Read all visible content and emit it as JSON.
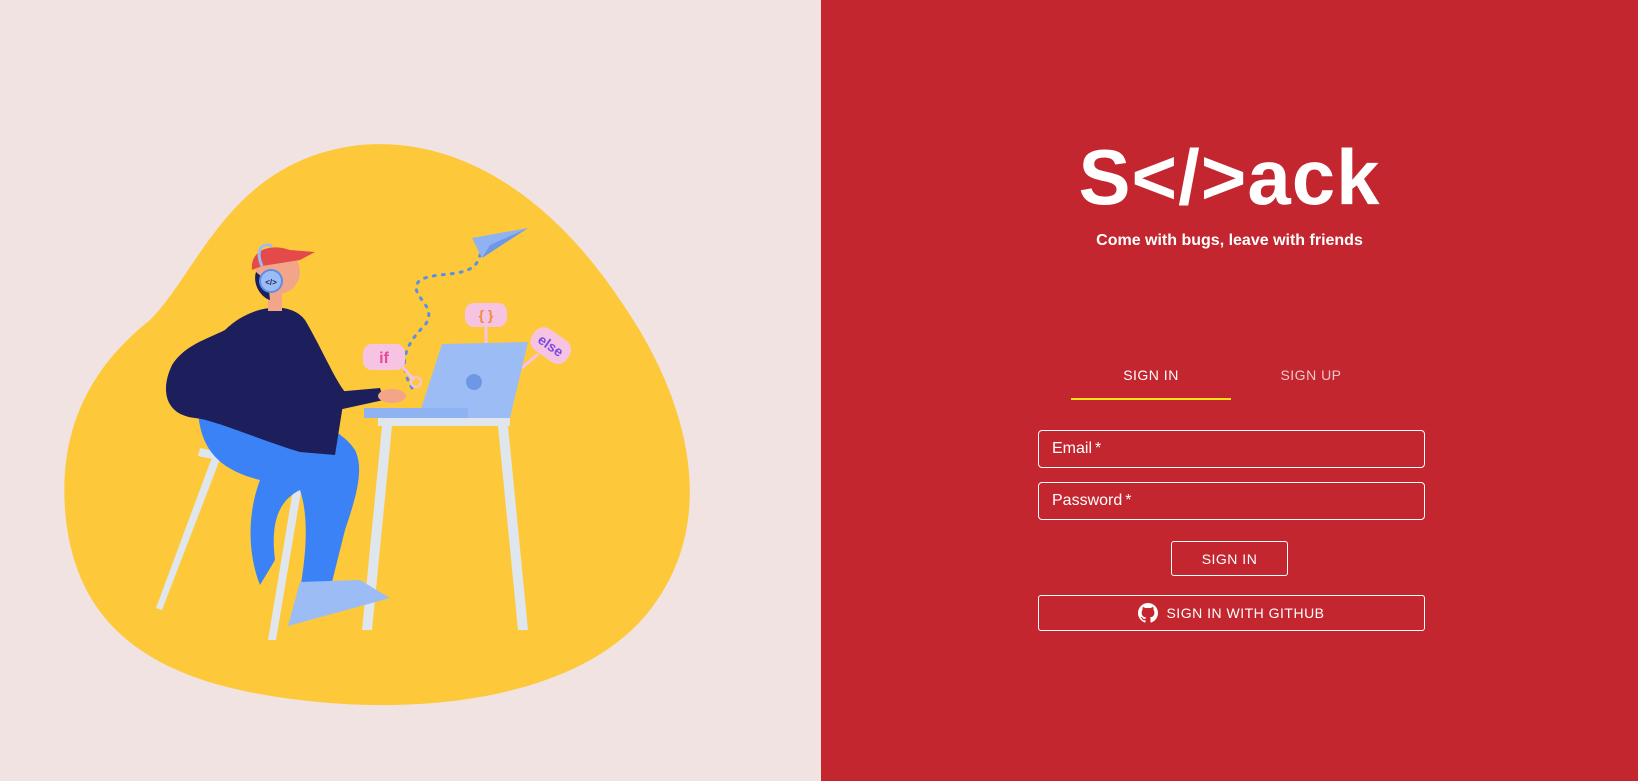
{
  "brand": {
    "logo_text": "S</>ack",
    "tagline": "Come with bugs, leave with friends"
  },
  "illustration": {
    "bubble_if": "if",
    "bubble_braces": "{ }",
    "bubble_else": "else",
    "headphone_code": "</>"
  },
  "tabs": [
    {
      "label": "SIGN IN",
      "active": true
    },
    {
      "label": "SIGN UP",
      "active": false
    }
  ],
  "form": {
    "email_label": "Email",
    "password_label": "Password",
    "required_mark": "*",
    "submit_label": "SIGN IN",
    "github_label": "SIGN IN WITH GITHUB"
  },
  "colors": {
    "left_bg": "#f0e3e2",
    "right_bg": "#c3262f",
    "blob": "#fdc93b",
    "tab_indicator": "#f3e01b"
  },
  "icons": {
    "github": "github-icon",
    "paper_plane": "paper-plane-icon"
  }
}
